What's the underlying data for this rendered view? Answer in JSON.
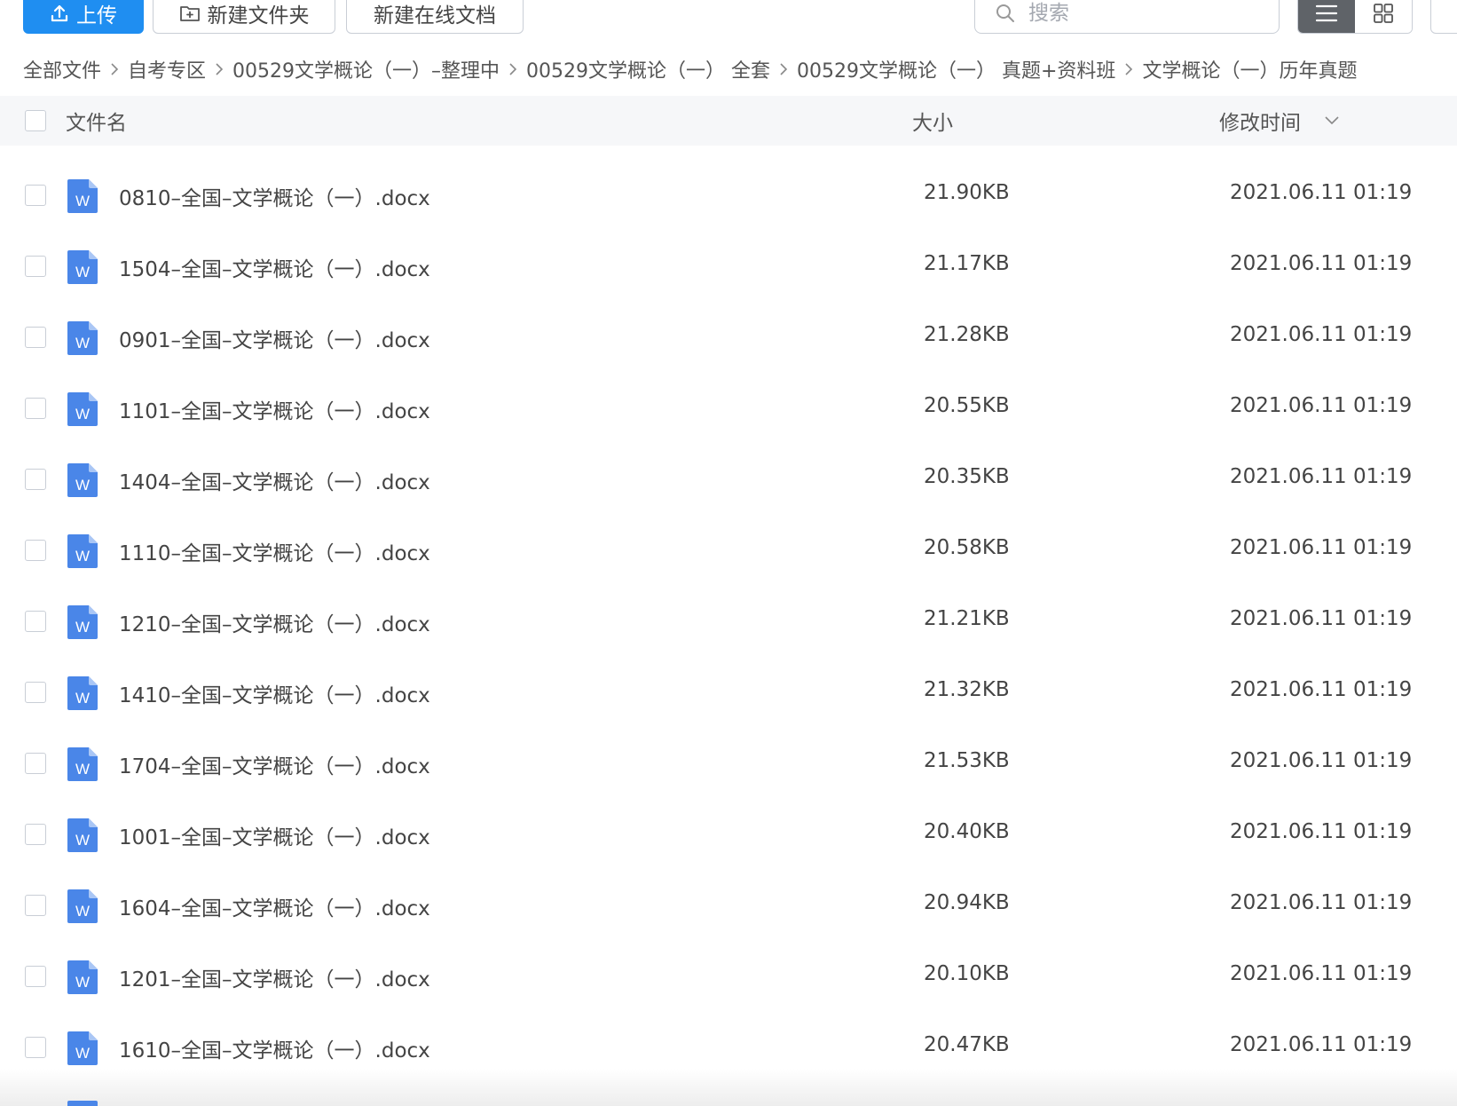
{
  "toolbar": {
    "upload_label": "上传",
    "new_folder_label": "新建文件夹",
    "new_online_doc_label": "新建在线文档",
    "search_placeholder": "搜索"
  },
  "breadcrumb": [
    "全部文件",
    "自考专区",
    "00529文学概论（一）–整理中",
    "00529文学概论（一） 全套",
    "00529文学概论（一） 真题+资料班",
    "文学概论（一）历年真题"
  ],
  "table": {
    "columns": {
      "name": "文件名",
      "size": "大小",
      "modified": "修改时间"
    },
    "files": [
      {
        "name": "0810–全国–文学概论（一）.docx",
        "size": "21.90KB",
        "modified": "2021.06.11 01:19"
      },
      {
        "name": "1504–全国–文学概论（一）.docx",
        "size": "21.17KB",
        "modified": "2021.06.11 01:19"
      },
      {
        "name": "0901–全国–文学概论（一）.docx",
        "size": "21.28KB",
        "modified": "2021.06.11 01:19"
      },
      {
        "name": "1101–全国–文学概论（一）.docx",
        "size": "20.55KB",
        "modified": "2021.06.11 01:19"
      },
      {
        "name": "1404–全国–文学概论（一）.docx",
        "size": "20.35KB",
        "modified": "2021.06.11 01:19"
      },
      {
        "name": "1110–全国–文学概论（一）.docx",
        "size": "20.58KB",
        "modified": "2021.06.11 01:19"
      },
      {
        "name": "1210–全国–文学概论（一）.docx",
        "size": "21.21KB",
        "modified": "2021.06.11 01:19"
      },
      {
        "name": "1410–全国–文学概论（一）.docx",
        "size": "21.32KB",
        "modified": "2021.06.11 01:19"
      },
      {
        "name": "1704–全国–文学概论（一）.docx",
        "size": "21.53KB",
        "modified": "2021.06.11 01:19"
      },
      {
        "name": "1001–全国–文学概论（一）.docx",
        "size": "20.40KB",
        "modified": "2021.06.11 01:19"
      },
      {
        "name": "1604–全国–文学概论（一）.docx",
        "size": "20.94KB",
        "modified": "2021.06.11 01:19"
      },
      {
        "name": "1201–全国–文学概论（一）.docx",
        "size": "20.10KB",
        "modified": "2021.06.11 01:19"
      },
      {
        "name": "1610–全国–文学概论（一）.docx",
        "size": "20.47KB",
        "modified": "2021.06.11 01:19"
      }
    ]
  },
  "icons": {
    "file_type": "word-doc-icon",
    "file_type_letter": "W",
    "upload": "upload-icon",
    "new_folder": "folder-plus-icon",
    "search": "search-icon",
    "list_view": "list-view-icon",
    "grid_view": "grid-view-icon",
    "sort": "chevron-down-icon"
  },
  "colors": {
    "accent": "#1f8ef1",
    "word_icon": "#4a86e8",
    "header_bg": "#f6f7f9",
    "list_view_active": "#5f6368"
  }
}
